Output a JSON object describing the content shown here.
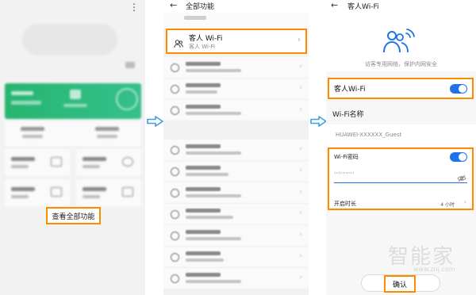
{
  "colors": {
    "highlight": "#ff8a00",
    "accent": "#1e73e8",
    "home_card": "#27b56f"
  },
  "panel1": {
    "view_all_button": "查看全部功能",
    "menu_icon": "more-vertical-icon"
  },
  "panel2": {
    "back_icon": "arrow-left-icon",
    "title": "全部功能",
    "guest_item": {
      "label": "客人 Wi-Fi",
      "sublabel": "客人 Wi-Fi",
      "icon": "guest-users-icon"
    }
  },
  "panel3": {
    "back_icon": "arrow-left-icon",
    "title": "客人Wi-Fi",
    "hero_icon": "guest-wifi-icon",
    "hero_desc": "访客专用网络，保护内网安全",
    "guest_toggle": {
      "label": "客人Wi-Fi",
      "on": true
    },
    "wifi_name_label": "Wi-Fi名称",
    "wifi_name_value": "HUAWEI-XXXXXX_Guest",
    "password": {
      "label": "Wi-Fi密码",
      "on": true,
      "value": "··········",
      "icon": "eye-off-icon"
    },
    "duration": {
      "label": "开启时长",
      "value": "4 小时"
    },
    "confirm_button": "确认"
  },
  "watermark": {
    "brand": "智能家",
    "url": "www.znj.com"
  }
}
